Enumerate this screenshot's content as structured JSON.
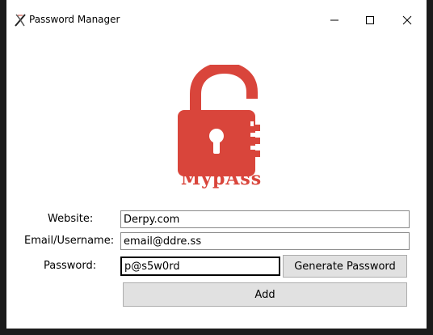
{
  "window": {
    "title": "Password Manager",
    "icons": {
      "app": "tk-feather-icon",
      "minimize": "minimize-icon",
      "maximize": "maximize-icon",
      "close": "close-icon"
    }
  },
  "logo": {
    "text": "MypAss",
    "icon": "padlock-open-icon",
    "color": "#d9453b"
  },
  "form": {
    "website_label": "Website:",
    "website_value": "Derpy.com",
    "email_label": "Email/Username:",
    "email_value": "email@ddre.ss",
    "password_label": "Password:",
    "password_value": "p@s5w0rd",
    "generate_label": "Generate Password",
    "add_label": "Add"
  }
}
